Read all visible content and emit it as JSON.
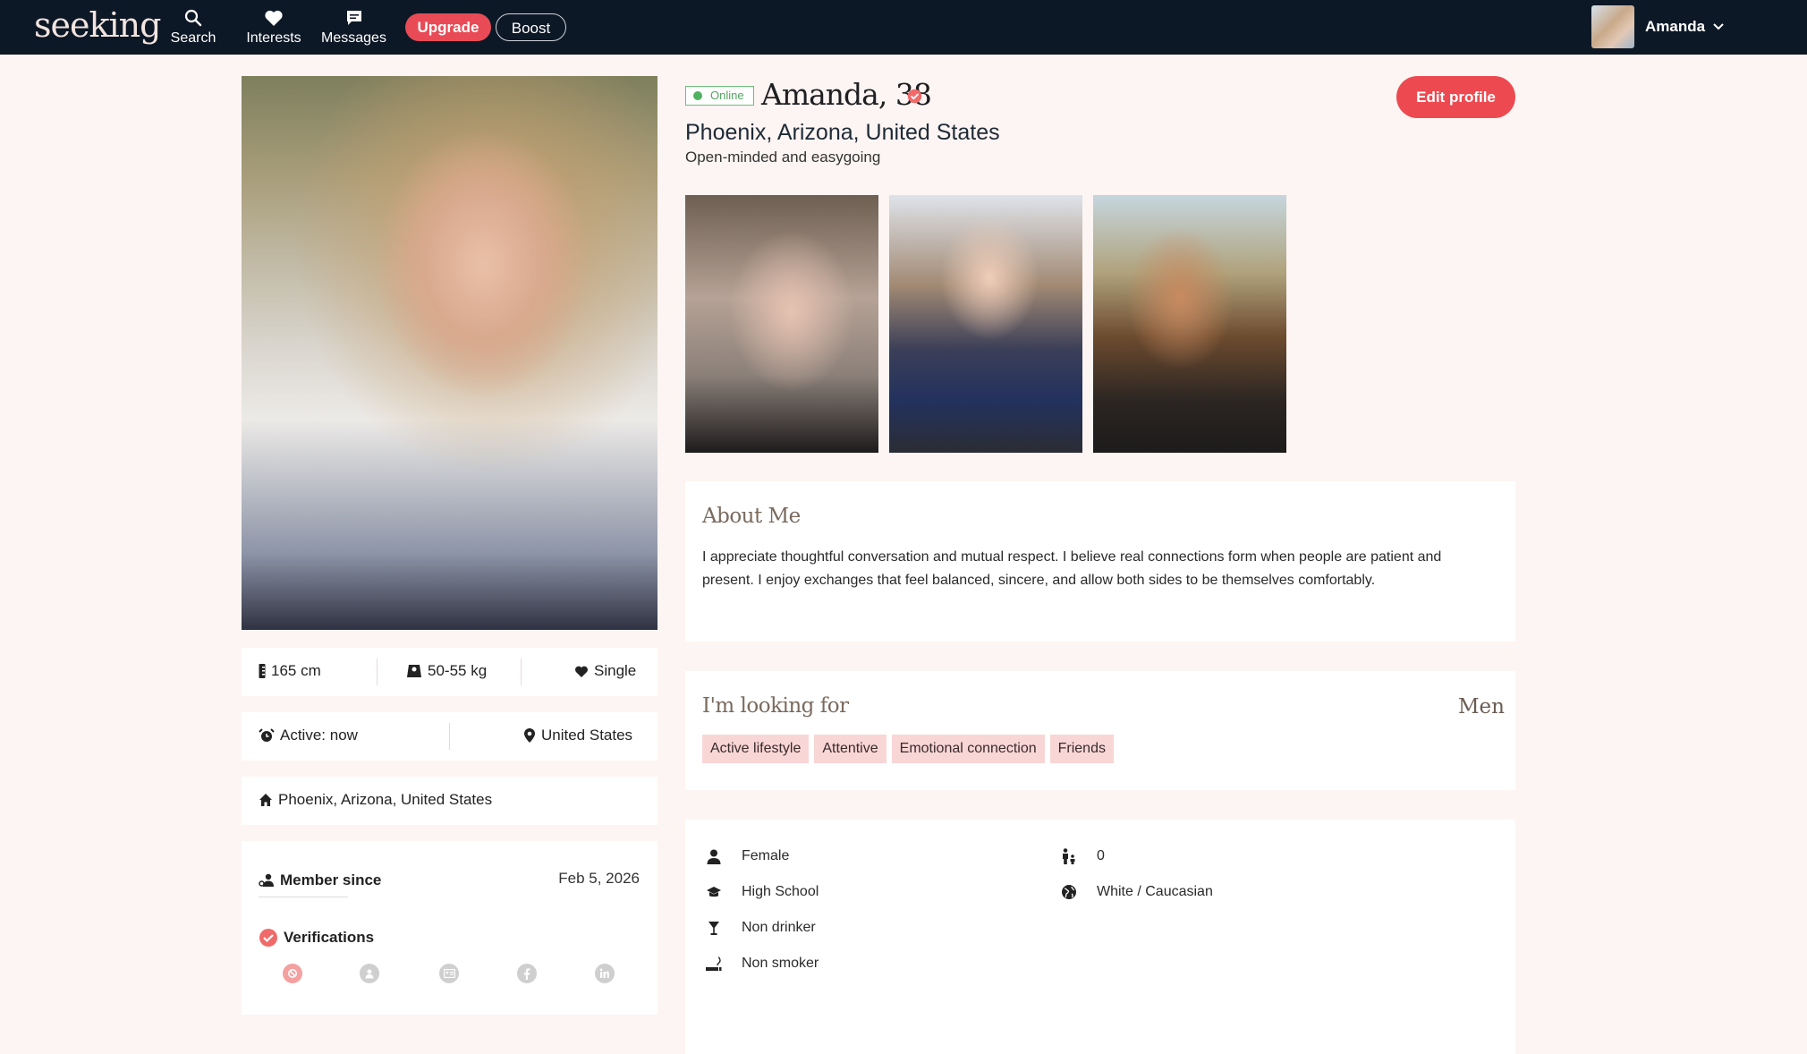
{
  "nav": {
    "logo": "seeking",
    "items": [
      {
        "label": "Search",
        "icon": "search-icon"
      },
      {
        "label": "Interests",
        "icon": "heart-icon"
      },
      {
        "label": "Messages",
        "icon": "message-icon"
      }
    ],
    "upgrade_label": "Upgrade",
    "boost_label": "Boost",
    "user_name": "Amanda"
  },
  "profile": {
    "online_label": "Online",
    "name_age": "Amanda, 38",
    "location": "Phoenix, Arizona, United States",
    "tagline": "Open-minded and easygoing",
    "edit_label": "Edit profile"
  },
  "stats": {
    "height": "165 cm",
    "weight": "50-55 kg",
    "relationship": "Single",
    "active": "Active: now",
    "country": "United States",
    "home": "Phoenix, Arizona, United States",
    "member_since_label": "Member since",
    "member_since_date": "Feb 5, 2026",
    "verifications_label": "Verifications"
  },
  "about": {
    "title": "About Me",
    "line1": "I appreciate thoughtful conversation and mutual respect. I believe real connections form when people are patient and",
    "line2": "present. I enjoy exchanges that feel balanced, sincere, and allow both sides to be themselves comfortably."
  },
  "looking": {
    "title": "I'm looking for",
    "target": "Men",
    "tags": [
      "Active lifestyle",
      "Attentive",
      "Emotional connection",
      "Friends"
    ]
  },
  "details": {
    "gender": "Female",
    "education": "High School",
    "drinking": "Non drinker",
    "smoking": "Non smoker",
    "children": "0",
    "ethnicity": "White / Caucasian"
  },
  "colors": {
    "accent": "#ec4a50",
    "navbar": "#0d1826",
    "page_bg": "#fdf5f3",
    "online": "#4fb25f",
    "tag_bg": "#f9d6d6"
  }
}
